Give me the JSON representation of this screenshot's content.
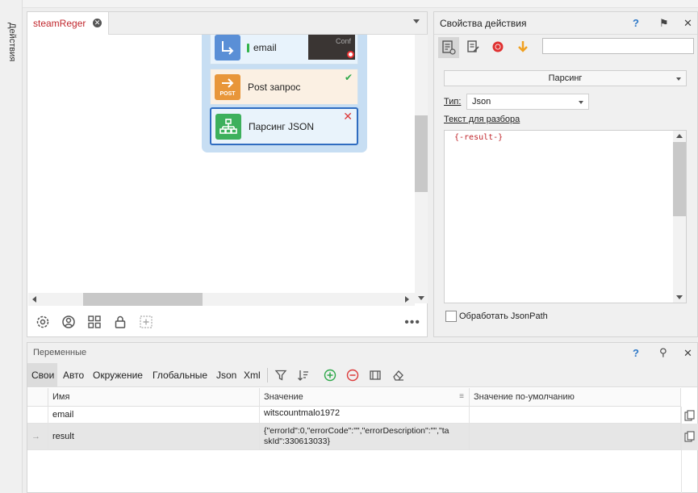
{
  "sidebar": {
    "label": "Действия"
  },
  "designer": {
    "tab_label": "steamReger",
    "blocks": {
      "email": {
        "label": "email",
        "thumb_text": "Conf"
      },
      "post": {
        "label": "Post запрос",
        "icon_text": "POST"
      },
      "json": {
        "label": "Парсинг JSON"
      }
    }
  },
  "properties": {
    "title": "Свойства действия",
    "help": "?",
    "pin": "⚑",
    "close": "✕",
    "mode_select": "Парсинг",
    "type_label": "Тип:",
    "type_value": "Json",
    "text_label": "Текст для разбора",
    "text_value": "{-result-}",
    "jsonpath_label": "Обработать JsonPath"
  },
  "variables": {
    "title": "Переменные",
    "help": "?",
    "close": "✕",
    "tabs": [
      "Свои",
      "Авто",
      "Окружение",
      "Глобальные",
      "Json",
      "Xml"
    ],
    "columns": [
      "Имя",
      "Значение",
      "Значение по-умолчанию"
    ],
    "rows": [
      {
        "name": "email",
        "value": "witscountmalo1972",
        "default": ""
      },
      {
        "name": "result",
        "value_line1": "{\"errorId\":0,\"errorCode\":\"\",\"errorDescription\":\"\",\"ta",
        "value_line2": "skId\":330613033}",
        "default": ""
      }
    ],
    "row_marker": "→"
  },
  "colors": {
    "tab_text": "#c0262c",
    "email_block": "#5a8fd6",
    "post_block": "#e8963a",
    "json_block": "#3db05c",
    "selected_border": "#2f6cc0",
    "success": "#2ea84a",
    "error": "#dc3a3a"
  }
}
